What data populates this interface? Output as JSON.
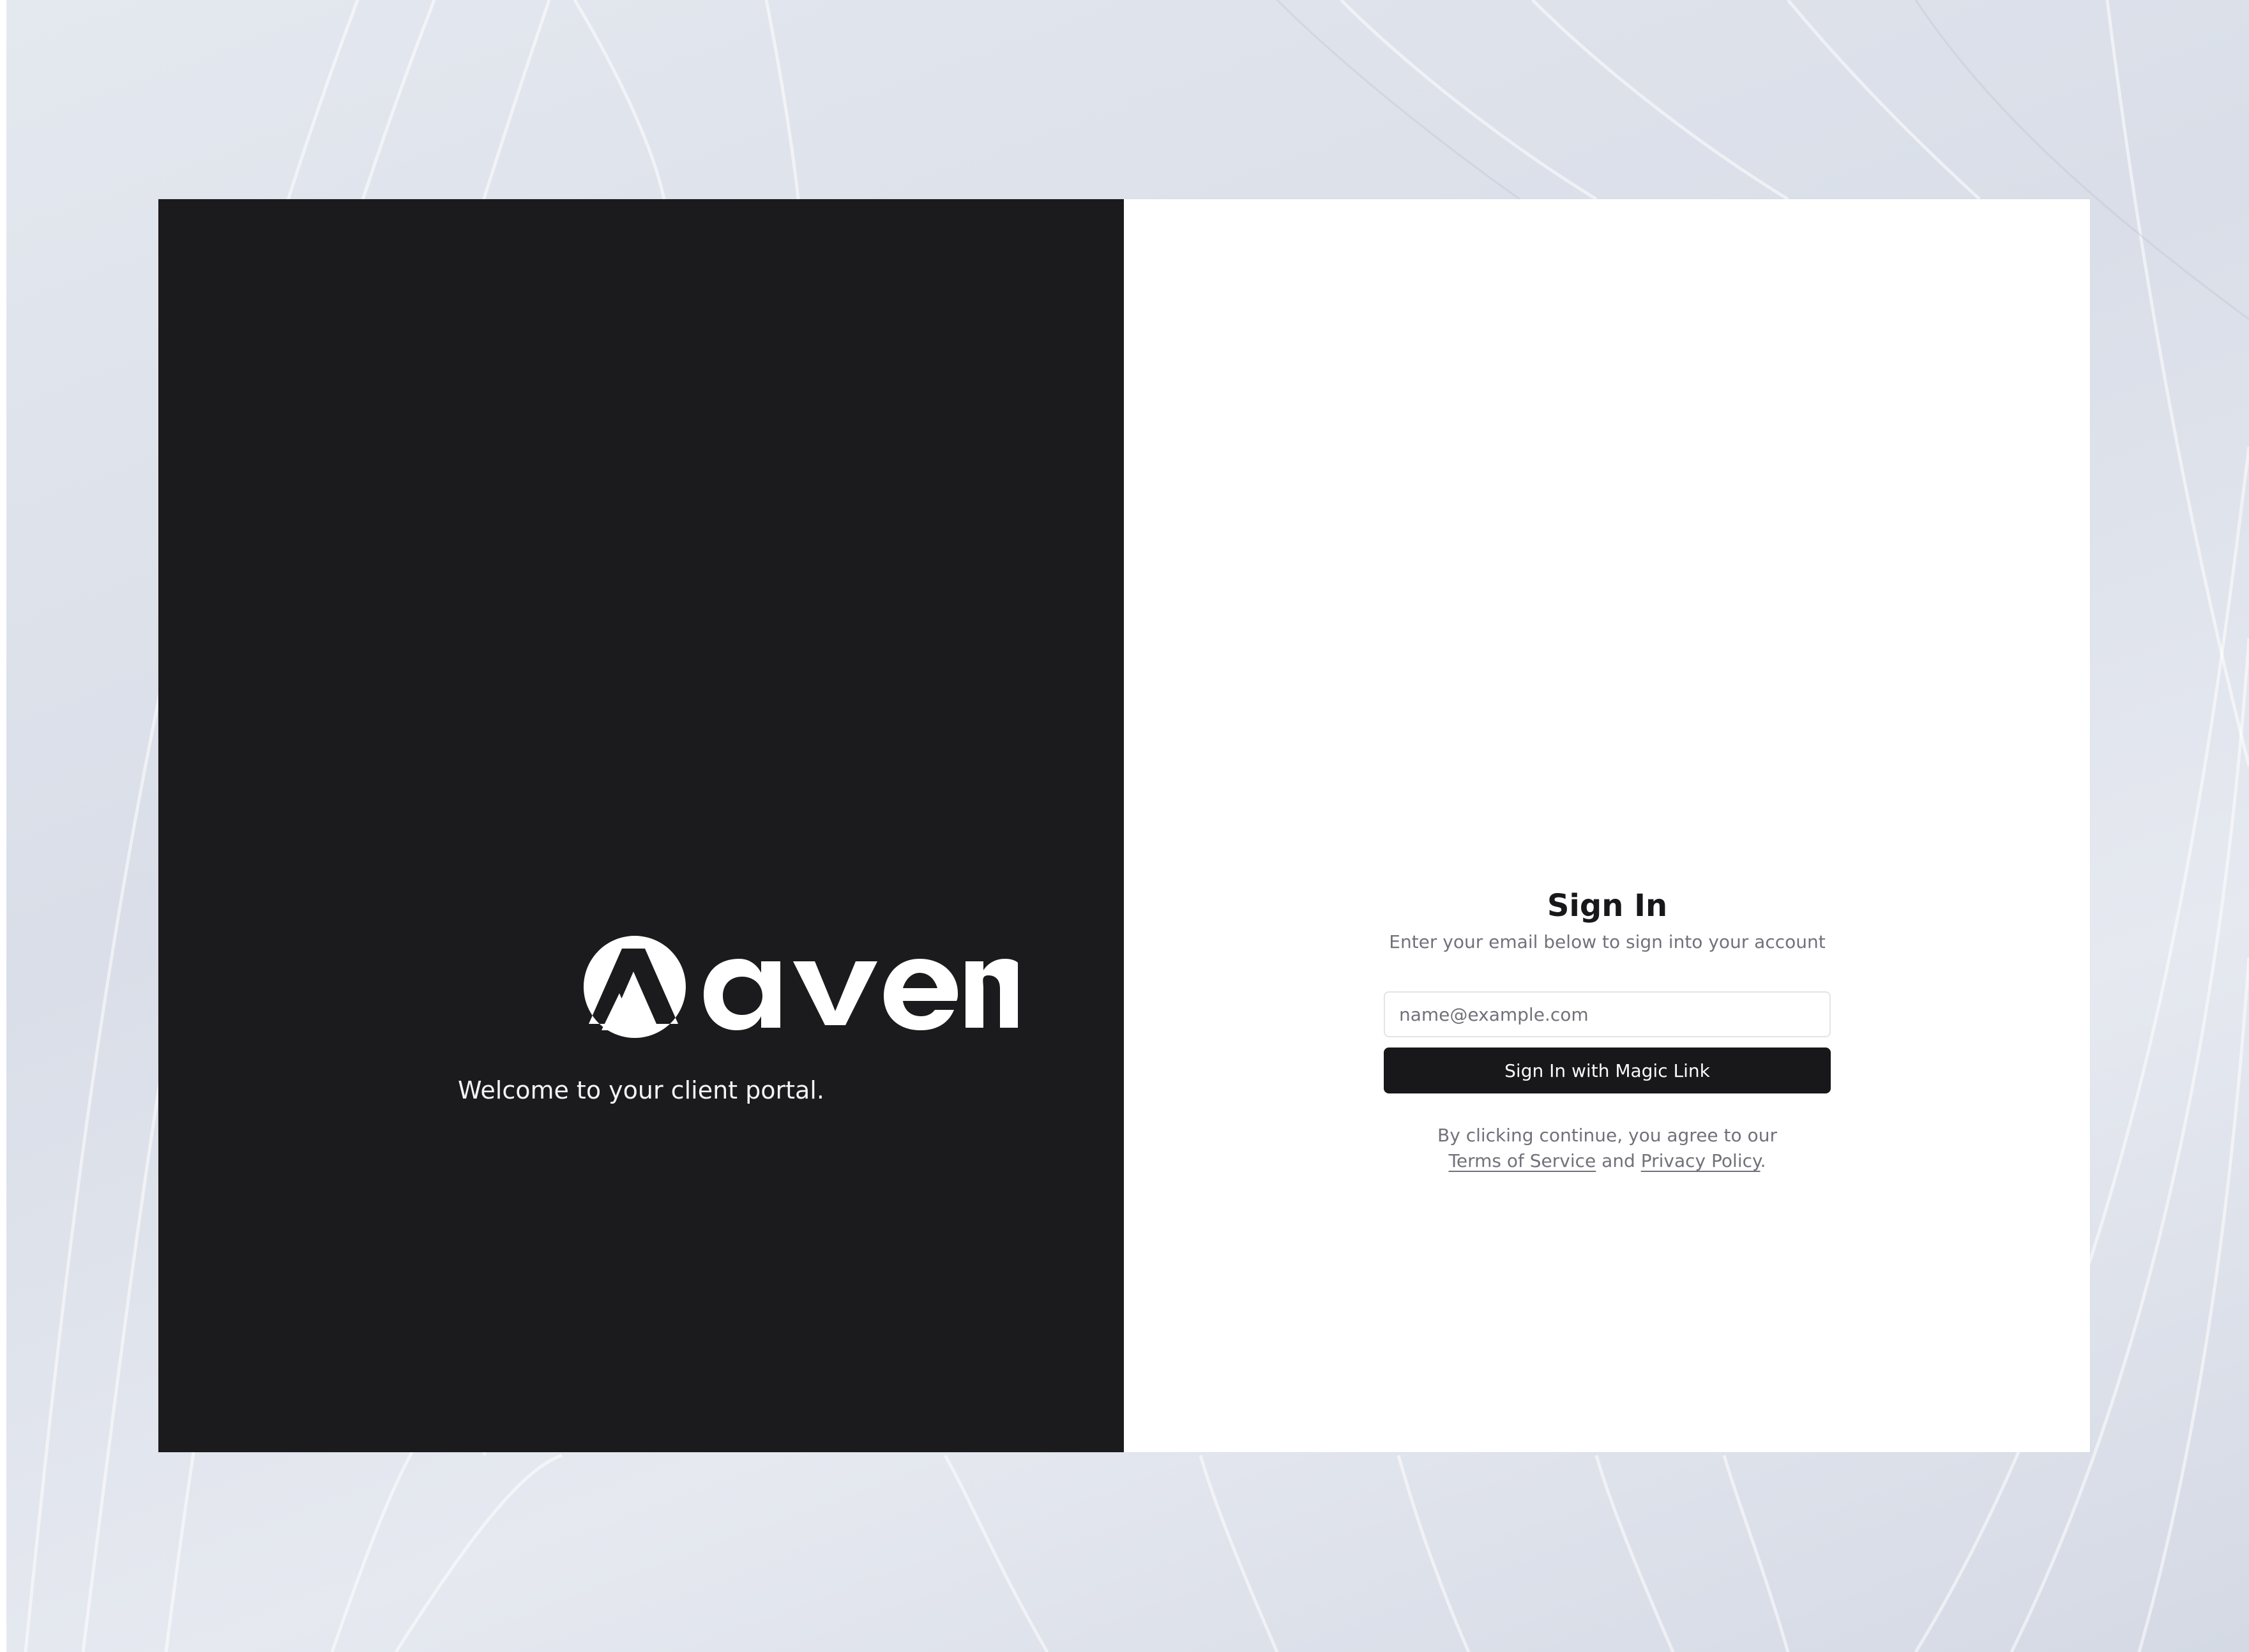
{
  "brand": {
    "name": "aven",
    "tagline": "Welcome to your client portal.",
    "panel_color": "#1b1b1d"
  },
  "signin": {
    "title": "Sign In",
    "subtitle": "Enter your email below to sign into your account",
    "email_placeholder": "name@example.com",
    "email_value": "",
    "submit_label": "Sign In with Magic Link",
    "legal_prefix": "By clicking continue, you agree to our",
    "terms_label": "Terms of Service",
    "and_text": "and",
    "privacy_label": "Privacy Policy",
    "legal_suffix": "."
  },
  "icons": {
    "logo_mark": "aven-logo-icon"
  },
  "colors": {
    "primary": "#18181b",
    "muted_text": "#71717a",
    "border": "#e4e4e7",
    "background": "#dde2ea"
  }
}
